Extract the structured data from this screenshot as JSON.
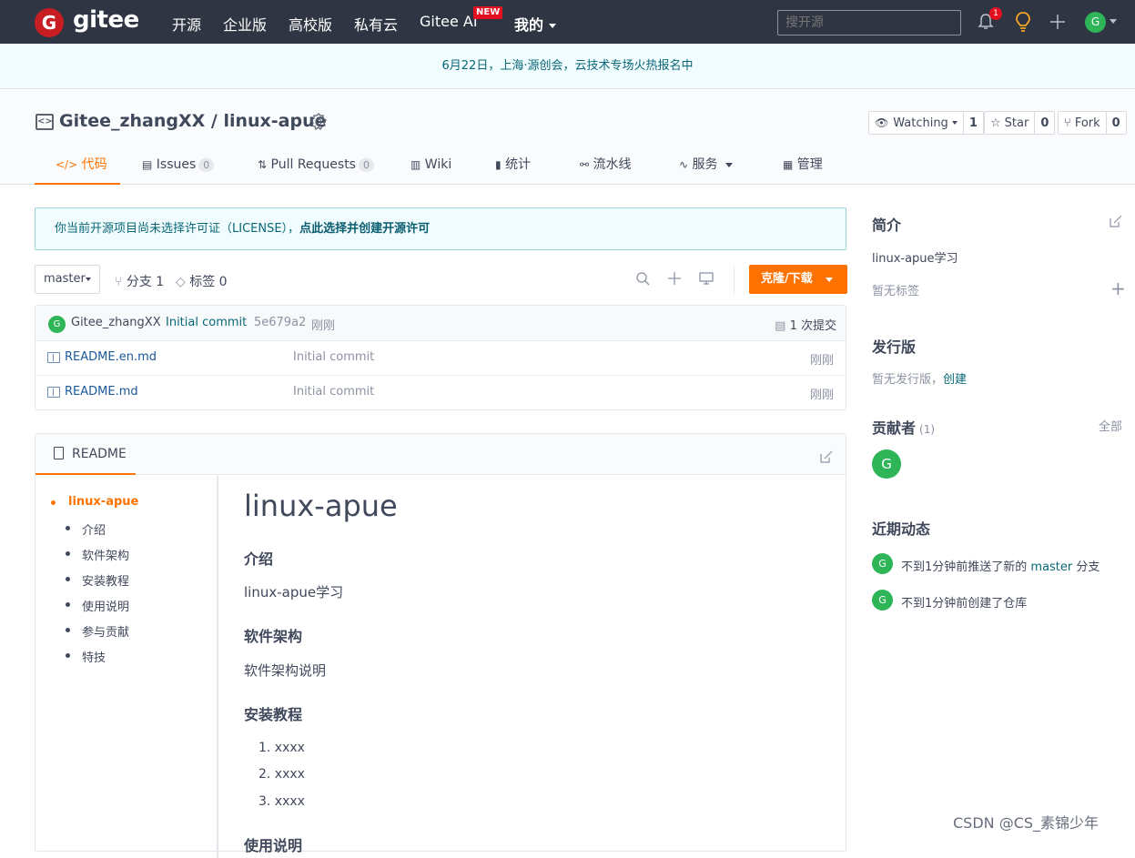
{
  "topbar": {
    "logo_letter": "G",
    "logo_text": "gitee",
    "nav": [
      "开源",
      "企业版",
      "高校版",
      "私有云",
      "Gitee AI",
      "我的"
    ],
    "new_badge": "NEW",
    "search_placeholder": "搜开源",
    "notification_count": "1",
    "avatar_letter": "G"
  },
  "announcement": "6月22日，上海·源创会，云技术专场火热报名中",
  "repo": {
    "title": "Gitee_zhangXX / linux-apue",
    "watch_label": "Watching",
    "watch_count": "1",
    "star_label": "Star",
    "star_count": "0",
    "fork_label": "Fork",
    "fork_count": "0",
    "tabs": [
      {
        "icon": "</>",
        "label": "代码"
      },
      {
        "icon": "▤",
        "label": "Issues",
        "count": "0"
      },
      {
        "icon": "⇅",
        "label": "Pull Requests",
        "count": "0"
      },
      {
        "icon": "▥",
        "label": "Wiki"
      },
      {
        "icon": "▮",
        "label": "统计"
      },
      {
        "icon": "⚯",
        "label": "流水线"
      },
      {
        "icon": "∿",
        "label": "服务"
      },
      {
        "icon": "▦",
        "label": "管理"
      }
    ]
  },
  "license": {
    "text": "你当前开源项目尚未选择许可证（LICENSE），",
    "link": "点此选择并创建开源许可"
  },
  "toolbar": {
    "branch": "master",
    "branches": "分支 1",
    "tags": "标签 0",
    "clone_label": "克隆/下载"
  },
  "commit": {
    "avatar": "G",
    "author": "Gitee_zhangXX",
    "message": "Initial commit",
    "hash": "5e679a2",
    "time": "刚刚",
    "count": "1 次提交"
  },
  "files": [
    {
      "name": "README.en.md",
      "commit": "Initial commit",
      "time": "刚刚"
    },
    {
      "name": "README.md",
      "commit": "Initial commit",
      "time": "刚刚"
    }
  ],
  "readme": {
    "tab_label": "README",
    "toc": [
      "linux-apue",
      "介绍",
      "软件架构",
      "安装教程",
      "使用说明",
      "参与贡献",
      "特技"
    ],
    "h1": "linux-apue",
    "h_intro": "介绍",
    "p_intro": "linux-apue学习",
    "h_arch": "软件架构",
    "p_arch": "软件架构说明",
    "h_install": "安装教程",
    "list": [
      "1. xxxx",
      "2. xxxx",
      "3. xxxx"
    ],
    "h_usage": "使用说明"
  },
  "sidebar": {
    "intro_title": "简介",
    "intro_text": "linux-apue学习",
    "no_tags": "暂无标签",
    "release_title": "发行版",
    "no_release": "暂无发行版，",
    "create_link": "创建",
    "contributors_title": "贡献者",
    "contributors_count": "(1)",
    "all_link": "全部",
    "contributor_avatar": "G",
    "activity_title": "近期动态",
    "activity1_pre": "不到1分钟前推送了新的 ",
    "activity1_branch": "master",
    "activity1_post": " 分支",
    "activity2": "不到1分钟前创建了仓库"
  },
  "watermark": "CSDN @CS_素锦少年",
  "colors": {
    "topbar": "#2f3542",
    "accent": "#fe7300",
    "link": "#0a6778",
    "avatar_green": "#2db558",
    "badge_red": "#e5101f"
  }
}
